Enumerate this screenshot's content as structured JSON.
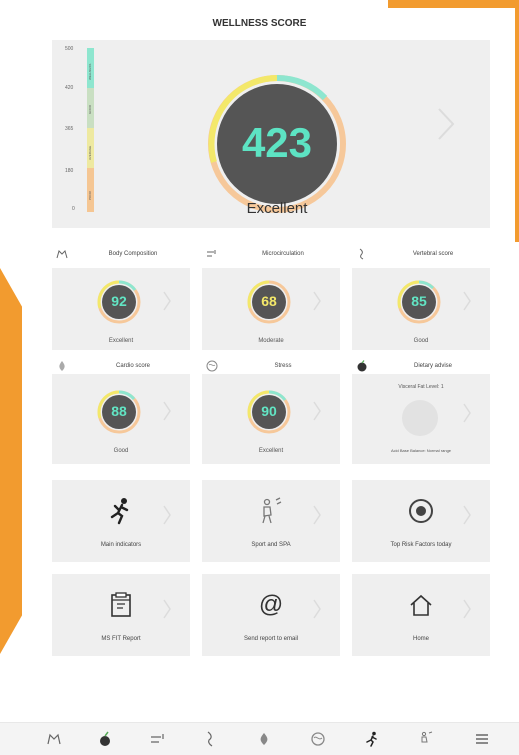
{
  "title": "WELLNESS SCORE",
  "overall": {
    "score": "423",
    "label": "Excellent",
    "scale_ticks": [
      "500",
      "420",
      "365",
      "180",
      "0"
    ],
    "scale_bands": [
      "WELLNESS",
      "GOOD",
      "AVERAGE",
      "POOR"
    ]
  },
  "metric_cards": [
    {
      "title": "Body Composition",
      "value": "92",
      "status": "Excellent",
      "icon": "body-composition-icon"
    },
    {
      "title": "Microcirculation",
      "value": "68",
      "status": "Moderate",
      "icon": "microcirculation-icon"
    },
    {
      "title": "Vertebral score",
      "value": "85",
      "status": "Good",
      "icon": "spine-icon"
    },
    {
      "title": "Cardio score",
      "value": "88",
      "status": "Good",
      "icon": "cardio-icon"
    },
    {
      "title": "Stress",
      "value": "90",
      "status": "Excellent",
      "icon": "brain-icon"
    }
  ],
  "dietary": {
    "title": "Dietary advise",
    "visceral": "Visceral Fat Level: 1",
    "acid": "Acid Base Balance: Normal range",
    "icon": "apple-icon"
  },
  "tiles": [
    {
      "label": "Main indicators",
      "icon": "running-person-icon"
    },
    {
      "label": "Sport and SPA",
      "icon": "spa-icon"
    },
    {
      "label": "Top Risk Factors today",
      "icon": "target-icon"
    },
    {
      "label": "MS FIT Report",
      "icon": "report-icon"
    },
    {
      "label": "Send report to email",
      "icon": "at-icon"
    },
    {
      "label": "Home",
      "icon": "home-icon"
    }
  ],
  "bottom_nav": [
    "body-composition-icon",
    "apple-icon",
    "microcirculation-icon",
    "spine-icon",
    "cardio-icon",
    "brain-icon",
    "running-person-icon",
    "spa-icon",
    "menu-icon"
  ],
  "colors": {
    "accent_teal": "#5de3c3",
    "orange": "#f29b2f",
    "ring_dark": "#555555",
    "yellow": "#f3e86a",
    "peach": "#f6c89a"
  }
}
